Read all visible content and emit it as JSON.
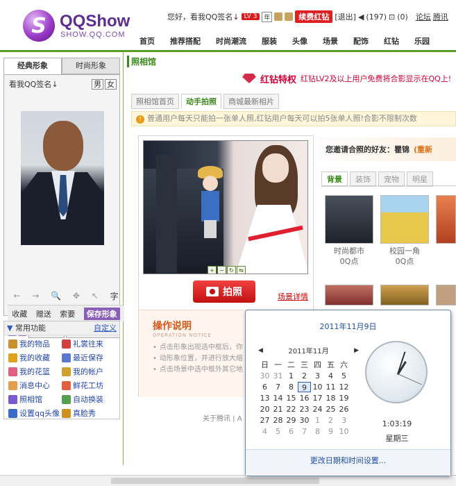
{
  "logo": {
    "title": "QQShow",
    "url_text": "SHOW.QQ.COM"
  },
  "topbar": {
    "greeting": "您好，看我QQ签名↓",
    "level": "LV 3",
    "year_badge": "年",
    "renew": "续费红钻",
    "logout": "[退出]",
    "messages": "(197)",
    "cart": "(0)",
    "forum": "论坛",
    "tencent": "腾讯"
  },
  "nav": [
    "首页",
    "推荐搭配",
    "时尚潮流",
    "服装",
    "头像",
    "场景",
    "配饰",
    "红钻",
    "乐园"
  ],
  "left": {
    "tabs": [
      "经典形象",
      "时尚形象"
    ],
    "sign": "看我QQ签名↓",
    "sex_m": "男",
    "sex_f": "女",
    "tools": [
      "←",
      "→",
      "🔍",
      "✥",
      "↖",
      "字"
    ],
    "actions": [
      "收藏",
      "赠送",
      "索要",
      "保存形象"
    ],
    "closet": [
      "我的衣柜",
      "身上/试穿物品"
    ],
    "funcs_title": "常用功能",
    "funcs_custom": "自定义",
    "funcs": [
      {
        "label": "我的物品",
        "color": "#c9902e"
      },
      {
        "label": "礼裳往来",
        "color": "#d24040"
      },
      {
        "label": "我的收藏",
        "color": "#e0a020"
      },
      {
        "label": "最近保存",
        "color": "#5a7ad0"
      },
      {
        "label": "我的花篮",
        "color": "#e06080"
      },
      {
        "label": "我的帐户",
        "color": "#d0a030"
      },
      {
        "label": "消息中心",
        "color": "#e0a050"
      },
      {
        "label": "鲜花工坊",
        "color": "#e06040"
      },
      {
        "label": "照相馆",
        "color": "#7a5ad0"
      },
      {
        "label": "自动换装",
        "color": "#50a050"
      },
      {
        "label": "设置qq头像",
        "color": "#3a6ac8"
      },
      {
        "label": "真脸秀",
        "color": "#d09020"
      }
    ]
  },
  "main": {
    "section": "照相馆",
    "vip_title": "红钻特权",
    "vip_sub": "红钻LV2及以上用户免费将合影显示在QQ上!",
    "tabs": [
      "照相馆首页",
      "动手拍照",
      "商城最新相片"
    ],
    "notice": "普通用户每天只能拍一张单人照,红钻用户每天可以拍5张单人照!合影不限制次数",
    "shoot": "拍照",
    "scene_detail": "场景详情",
    "howto_title": "操作说明",
    "howto_sub": "OPERATION NOTICE",
    "howto_items": [
      "点击形象出现选中框后，你",
      "动形象位置，并进行放大缩",
      "点击场景中选中框外其它地"
    ],
    "friend_label": "您邀请合照的好友：",
    "friend_name": "瞿锦",
    "friend_more": "(重新",
    "gallery_tabs": [
      "背景",
      "装饰",
      "宠物",
      "明星"
    ],
    "thumbs": [
      {
        "name": "时尚都市",
        "price": "0Q点",
        "color": "#3a3f4a"
      },
      {
        "name": "校园一角",
        "price": "0Q点",
        "color": "#d8b848"
      },
      {
        "name": "",
        "price": "",
        "color": "#c85a2a"
      }
    ],
    "footer_links": [
      "论坛",
      "服"
    ],
    "footer_text": "关于腾讯  |  A"
  },
  "clock": {
    "date_title": "2011年11月9日",
    "month": "2011年11月",
    "weekdays": [
      "日",
      "一",
      "二",
      "三",
      "四",
      "五",
      "六"
    ],
    "days": [
      "30",
      "31",
      "1",
      "2",
      "3",
      "4",
      "5",
      "6",
      "7",
      "8",
      "9",
      "10",
      "11",
      "12",
      "13",
      "14",
      "15",
      "16",
      "17",
      "18",
      "19",
      "20",
      "21",
      "22",
      "23",
      "24",
      "25",
      "26",
      "27",
      "28",
      "29",
      "30",
      "1",
      "2",
      "3",
      "4",
      "5",
      "6",
      "7",
      "8",
      "9",
      "10"
    ],
    "time": "1:03:19",
    "weekday": "星期三",
    "change_link": "更改日期和时间设置..."
  }
}
